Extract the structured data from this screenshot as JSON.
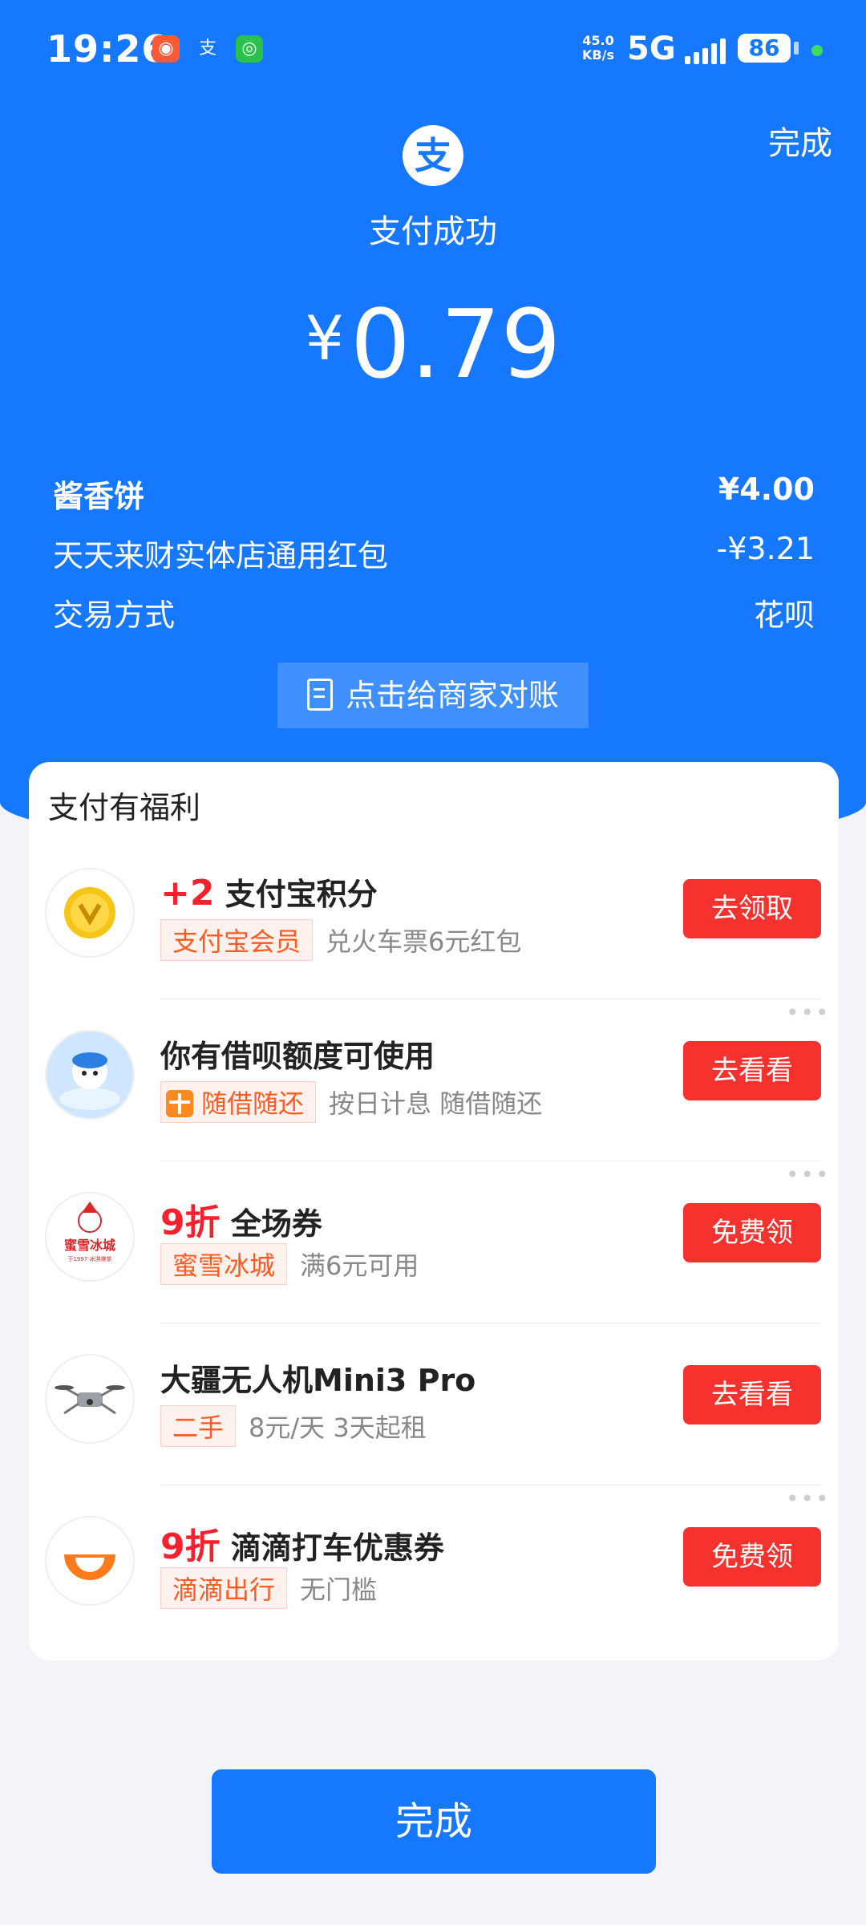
{
  "status_bar": {
    "time": "19:26",
    "net_speed_top": "45.0",
    "net_speed_bottom": "KB/s",
    "network": "5G",
    "battery": "86"
  },
  "header": {
    "done_label": "完成",
    "logo_char": "支",
    "status": "支付成功",
    "currency": "¥",
    "amount": "0.79"
  },
  "details": [
    {
      "label": "酱香饼",
      "value": "¥4.00"
    },
    {
      "label": "天天来财实体店通用红包",
      "value": "-¥3.21"
    },
    {
      "label": "交易方式",
      "value": "花呗"
    }
  ],
  "reconcile_label": "点击给商家对账",
  "benefits": {
    "title": "支付有福利",
    "items": [
      {
        "highlight": "+2",
        "title": "支付宝积分",
        "tag": "支付宝会员",
        "desc": "兑火车票6元红包",
        "button": "去领取"
      },
      {
        "highlight": "",
        "title": "你有借呗额度可使用",
        "tag": "随借随还",
        "desc": "按日计息 随借随还",
        "button": "去看看"
      },
      {
        "highlight": "9折",
        "title": "全场券",
        "tag": "蜜雪冰城",
        "desc": "满6元可用",
        "button": "免费领"
      },
      {
        "highlight": "",
        "title": "大疆无人机Mini3 Pro",
        "tag": "二手",
        "desc": "8元/天 3天起租",
        "button": "去看看"
      },
      {
        "highlight": "9折",
        "title": "滴滴打车优惠券",
        "tag": "滴滴出行",
        "desc": "无门槛",
        "button": "免费领"
      }
    ],
    "more_glyph": "•••"
  },
  "logo_texts": {
    "mixue_name": "蜜雪冰城",
    "mixue_sub": "于1997·冰淇淋茶"
  },
  "footer": {
    "done_label": "完成"
  },
  "colors": {
    "primary": "#1677ff",
    "button_red": "#f5322d",
    "tag_orange": "#ff5a1f"
  }
}
